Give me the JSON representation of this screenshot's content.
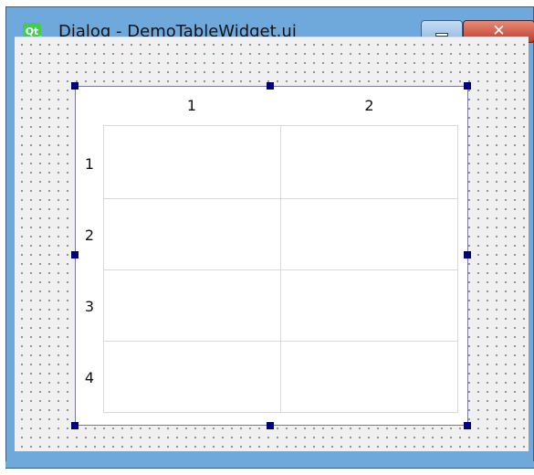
{
  "window": {
    "title": "Dialog - DemoTableWidget.ui",
    "app_icon_text": "Qt",
    "close_glyph": "✕"
  },
  "table": {
    "column_headers": [
      "1",
      "2"
    ],
    "row_headers": [
      "1",
      "2",
      "3",
      "4"
    ]
  },
  "colors": {
    "titlebar": "#6fa9dc",
    "selection_handle": "#00007f",
    "close_button": "#c13a25"
  }
}
